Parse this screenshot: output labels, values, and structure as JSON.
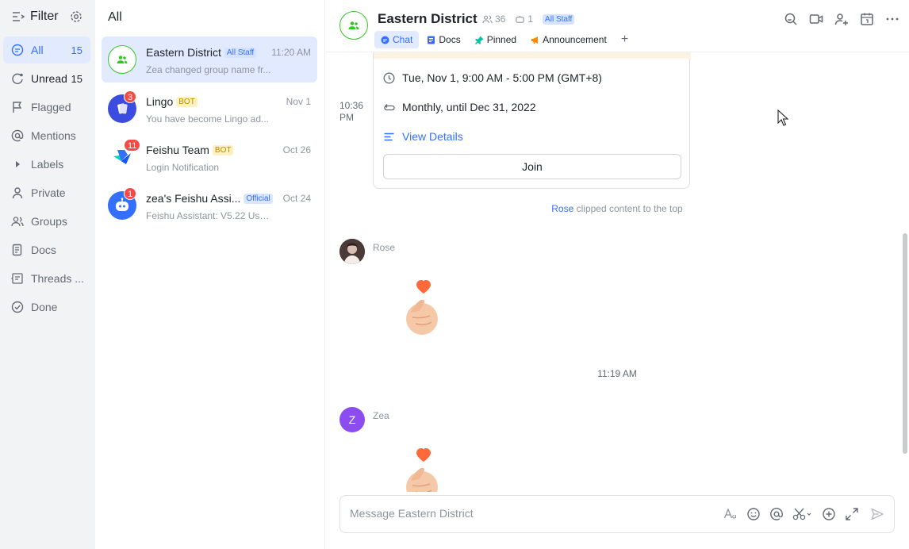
{
  "sidebar": {
    "title": "Filter",
    "items": [
      {
        "label": "All",
        "count": "15",
        "icon": "chat-icon"
      },
      {
        "label": "Unread",
        "count": "15",
        "icon": "unread-icon"
      },
      {
        "label": "Flagged",
        "count": "",
        "icon": "flag-icon"
      },
      {
        "label": "Mentions",
        "count": "",
        "icon": "at-icon"
      },
      {
        "label": "Labels",
        "count": "",
        "icon": "caret-right-icon"
      },
      {
        "label": "Private",
        "count": "",
        "icon": "person-icon"
      },
      {
        "label": "Groups",
        "count": "",
        "icon": "group-icon"
      },
      {
        "label": "Docs",
        "count": "",
        "icon": "doc-icon"
      },
      {
        "label": "Threads ...",
        "count": "",
        "icon": "thread-icon"
      },
      {
        "label": "Done",
        "count": "",
        "icon": "check-icon"
      }
    ]
  },
  "chatlist": {
    "title": "All",
    "chats": [
      {
        "name": "Eastern District",
        "tag": "All Staff",
        "time": "11:20 AM",
        "preview": "Zea changed group name fr...",
        "badge": ""
      },
      {
        "name": "Lingo",
        "tag": "BOT",
        "time": "Nov 1",
        "preview": "You have become Lingo ad...",
        "badge": "3"
      },
      {
        "name": "Feishu Team",
        "tag": "BOT",
        "time": "Oct 26",
        "preview": "Login Notification",
        "badge": "11"
      },
      {
        "name": "zea's Feishu Assi...",
        "tag": "Official",
        "time": "Oct 24",
        "preview": "Feishu Assistant: V5.22 Use ...",
        "badge": "1"
      }
    ]
  },
  "header": {
    "title": "Eastern District",
    "members": "36",
    "bots": "1",
    "tag": "All Staff",
    "tabs": [
      {
        "label": "Chat",
        "icon": "chat-bubble-icon"
      },
      {
        "label": "Docs",
        "icon": "doc-icon"
      },
      {
        "label": "Pinned",
        "icon": "pin-icon"
      },
      {
        "label": "Announcement",
        "icon": "megaphone-icon"
      }
    ],
    "tab_add": "+"
  },
  "messages": {
    "time_left": "10:36 PM",
    "event_card": {
      "datetime": "Tue, Nov 1, 9:00 AM - 5:00 PM (GMT+8)",
      "recurrence": "Monthly, until Dec 31, 2022",
      "details_link": "View Details",
      "join_label": "Join"
    },
    "system_note": {
      "user": "Rose",
      "text": " clipped content to the top"
    },
    "rose": {
      "name": "Rose"
    },
    "timestamp": "11:19 AM",
    "zea": {
      "name": "Zea",
      "initial": "Z"
    }
  },
  "composer": {
    "placeholder": "Message Eastern District"
  },
  "colors": {
    "accent": "#3370ff",
    "sidebar_bg": "#f2f3f5",
    "badge_red": "#f54a45",
    "group_green": "#34c724",
    "zea_purple": "#8c4cf0"
  }
}
